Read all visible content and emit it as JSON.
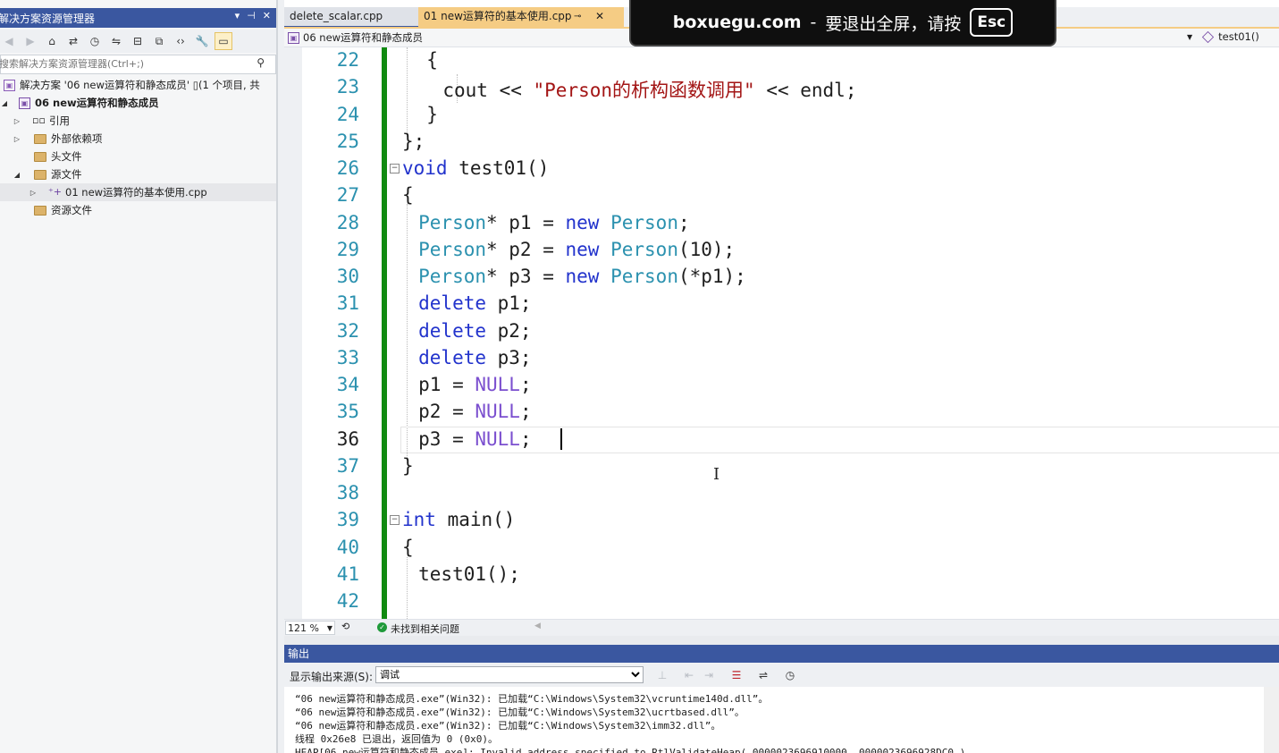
{
  "solution_explorer": {
    "title": "解决方案资源管理器",
    "title_buttons": [
      "▾",
      "⊣",
      "✕"
    ],
    "search_placeholder": "搜索解决方案资源管理器(Ctrl+;)",
    "items": [
      {
        "label": "解决方案 '06 new运算符和静态成员' ▯(1 个项目, 共"
      },
      {
        "label": "06 new运算符和静态成员"
      },
      {
        "label": "引用"
      },
      {
        "label": "外部依赖项"
      },
      {
        "label": "头文件"
      },
      {
        "label": "源文件"
      },
      {
        "label": "01 new运算符的基本使用.cpp"
      },
      {
        "label": "资源文件"
      }
    ]
  },
  "tabs": [
    {
      "label": "delete_scalar.cpp"
    },
    {
      "label": "01 new运算符的基本使用.cpp",
      "pin": "⊸",
      "close": "✕"
    }
  ],
  "navbar": {
    "scope": "06 new运算符和静态成员",
    "member": "test01()"
  },
  "banner": {
    "site": "boxuegu.com",
    "dash": "-",
    "msg": "要退出全屏，请按",
    "key": "Esc"
  },
  "editor": {
    "line_numbers": [
      "22",
      "23",
      "24",
      "25",
      "26",
      "27",
      "28",
      "29",
      "30",
      "31",
      "32",
      "33",
      "34",
      "35",
      "36",
      "37",
      "38",
      "39",
      "40",
      "41",
      "42"
    ],
    "current_line": "36",
    "code_lines": [
      "{",
      "cout << \"Person的析构函数调用\" << endl;",
      "}",
      "};",
      "void test01()",
      "{",
      "Person* p1 = new Person;",
      "Person* p2 = new Person(10);",
      "Person* p3 = new Person(*p1);",
      "delete p1;",
      "delete p2;",
      "delete p3;",
      "p1 = NULL;",
      "p2 = NULL;",
      "p3 = NULL;",
      "}",
      "",
      "int main()",
      "{",
      "test01();",
      ""
    ]
  },
  "status": {
    "zoom": "121 %",
    "issues": "未找到相关问题"
  },
  "output": {
    "title": "输出",
    "source_label": "显示输出来源(S):",
    "source_value": "调试",
    "lines": [
      "“06 new运算符和静态成员.exe”(Win32): 已加载“C:\\Windows\\System32\\vcruntime140d.dll”。",
      "“06 new运算符和静态成员.exe”(Win32): 已加载“C:\\Windows\\System32\\ucrtbased.dll”。",
      "“06 new运算符和静态成员.exe”(Win32): 已加载“C:\\Windows\\System32\\imm32.dll”。",
      "线程 0x26e8 已退出，返回值为 0 (0x0)。",
      "HEAP[06 new运算符和静态成员.exe]: Invalid address specified to RtlValidateHeap( 0000023696910000, 0000023696928DC0 )"
    ]
  }
}
